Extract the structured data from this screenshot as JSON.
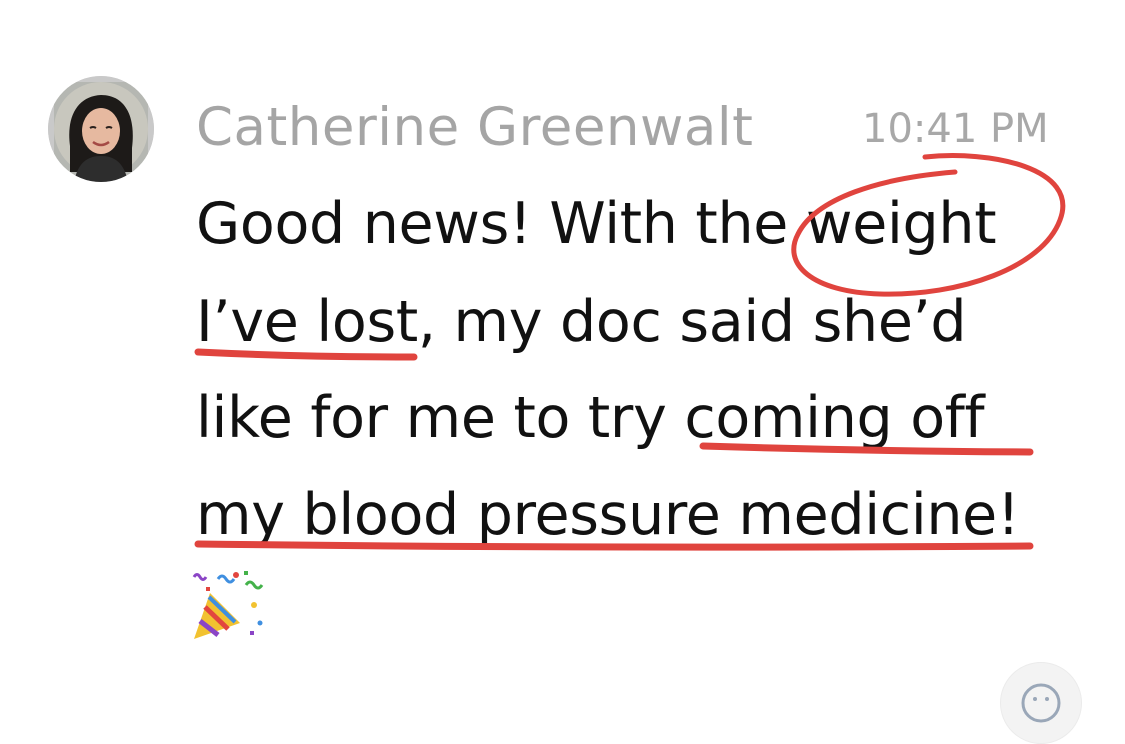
{
  "message": {
    "sender": {
      "name": "Catherine Greenwalt",
      "avatar_icon": "user-avatar-photo"
    },
    "time": "10:41 PM",
    "lines": [
      "Good news! With the weight",
      "I’ve lost, my doc said she’d",
      "like for me to try coming off",
      "my blood pressure medicine!"
    ],
    "emoji": "party-popper-icon"
  },
  "annotations": {
    "color": "#e0443e",
    "circled_phrase": "weight",
    "underlined_phrases": [
      "I’ve lost",
      "coming off",
      "my blood pressure medicine!"
    ]
  },
  "reaction_button_icon": "add-reaction-icon"
}
